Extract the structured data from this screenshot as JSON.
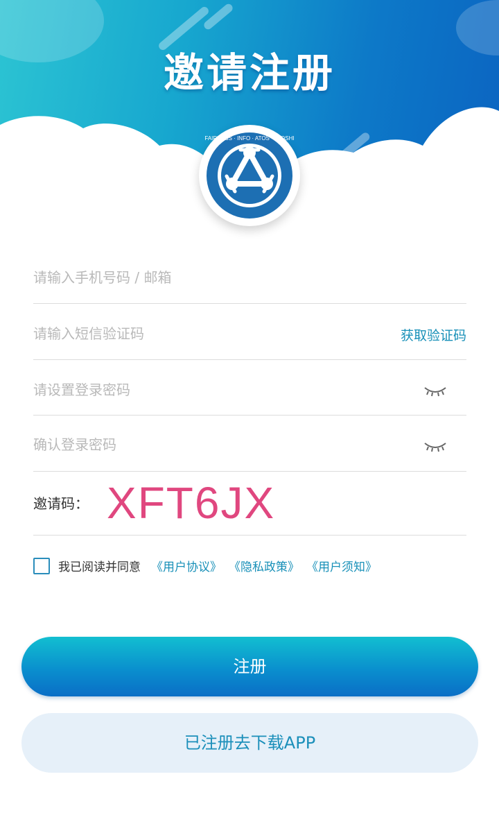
{
  "header": {
    "title": "邀请注册",
    "logo_text": "FAIRNESS · INFO · ATOS · ATOSHI"
  },
  "form": {
    "phone_placeholder": "请输入手机号码 / 邮箱",
    "sms_placeholder": "请输入短信验证码",
    "get_code_label": "获取验证码",
    "password_placeholder": "请设置登录密码",
    "confirm_placeholder": "确认登录密码",
    "invite_label": "邀请码：",
    "invite_code": "XFT6JX"
  },
  "agreement": {
    "prefix": "我已阅读并同意",
    "links": [
      "《用户协议》",
      "《隐私政策》",
      "《用户须知》"
    ],
    "checked": false
  },
  "buttons": {
    "register": "注册",
    "download": "已注册去下载APP"
  },
  "colors": {
    "accent": "#1890b8",
    "invite_code": "#e0477f",
    "header_start": "#2cc4d3",
    "header_end": "#0b63c1"
  },
  "icons": {
    "eye": "eye-closed-icon",
    "checkbox": "checkbox-icon"
  }
}
